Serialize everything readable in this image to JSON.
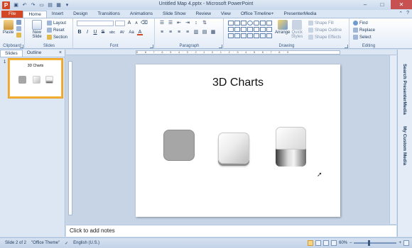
{
  "titlebar": {
    "app_icon_letter": "P",
    "doc_title": "Untitled Map 4.pptx  -  Microsoft PowerPoint",
    "qat_icons": [
      "save-icon",
      "undo-icon",
      "redo-icon",
      "new-icon",
      "open-icon",
      "print-icon",
      "customize-icon"
    ],
    "min": "–",
    "max": "□",
    "close": "✕"
  },
  "tabs": [
    "File",
    "Home",
    "Insert",
    "Design",
    "Transitions",
    "Animations",
    "Slide Show",
    "Review",
    "View",
    "Office Timeline+",
    "PresenterMedia"
  ],
  "active_tab": "Home",
  "ribbon": {
    "clipboard": {
      "paste": "Paste",
      "label": "Clipboard"
    },
    "slides": {
      "new_slide_line1": "New",
      "new_slide_line2": "Slide",
      "layout": "Layout",
      "reset": "Reset",
      "section": "Section",
      "label": "Slides"
    },
    "font": {
      "label": "Font",
      "grow": "A",
      "shrink": "A",
      "bold": "B",
      "italic": "I",
      "underline": "U",
      "strike": "S",
      "shadow": "abc",
      "spacing": "AV",
      "case": "Aa",
      "color": "A"
    },
    "paragraph": {
      "label": "Paragraph"
    },
    "drawing": {
      "arrange": "Arrange",
      "quick_styles_line1": "Quick",
      "quick_styles_line2": "Styles",
      "shape_fill": "Shape Fill",
      "shape_outline": "Shape Outline",
      "shape_effects": "Shape Effects",
      "label": "Drawing"
    },
    "editing": {
      "find": "Find",
      "replace": "Replace",
      "select": "Select",
      "label": "Editing"
    }
  },
  "leftpane": {
    "tab_slides": "Slides",
    "tab_outline": "Outline",
    "close": "×",
    "slide_number": "1",
    "thumb_title": "3D Charts"
  },
  "slide": {
    "title": "3D Charts"
  },
  "ruler_text": "9 · 8 · 7 · 6 · 5 · 4 · 3 · 2 · 1 · 0 · 1 · 2 · 3 · 4 · 5 · 6 · 7 · 8 · 9",
  "sidepanel": {
    "search_label": "Search PresenterMedia",
    "custom_label": "My Custom Media"
  },
  "notes": {
    "placeholder": "Click to add notes"
  },
  "statusbar": {
    "slide_info": "Slide 2 of 2",
    "theme": "\"Office Theme\"",
    "language": "English (U.S.)",
    "zoom": "60%",
    "zoom_minus": "–",
    "zoom_plus": "+"
  }
}
